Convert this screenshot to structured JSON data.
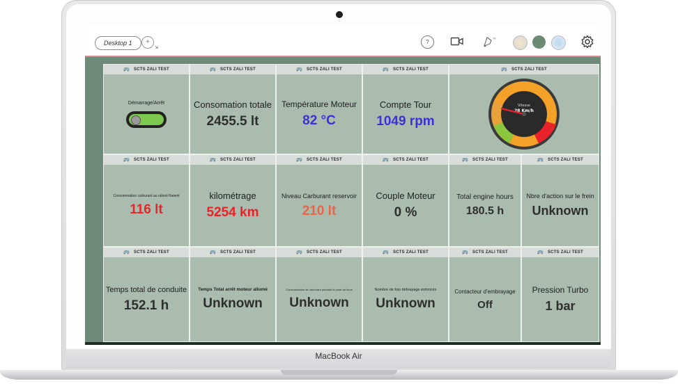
{
  "device": {
    "brand": "MacBook Air"
  },
  "toolbar": {
    "desktop_tab": "Desktop 1",
    "add_tab": "+",
    "help": "?",
    "colors": {
      "accent_line": "#d88a93"
    }
  },
  "dashboard": {
    "tile_header": "SCTS ZALI TEST",
    "colors": {
      "background": "#6e8a79",
      "tile": "#a9bcae",
      "red": "#e8232a",
      "blue": "#3e2fd6",
      "orange": "#e8644a"
    },
    "tiles": {
      "demarrage": {
        "label": "Démarrage/Arrêt"
      },
      "consommation": {
        "label": "Consomation totale",
        "value": "2455.5 lt"
      },
      "temperature": {
        "label": "Température Moteur",
        "value": "82 °C"
      },
      "compte_tour": {
        "label": "Compte Tour",
        "value": "1049 rpm"
      },
      "speed_gauge": {
        "title": "Vitesse",
        "value": "28 Km/h"
      },
      "consommation_ralenti": {
        "label": "Consommation carburant au ralenti Ralenti",
        "value": "116 lt"
      },
      "kilometrage": {
        "label": "kilométrage",
        "value": "5254 km"
      },
      "niveau_carburant": {
        "label": "Niveau Carburant reservoir",
        "value": "210 lt"
      },
      "couple_moteur": {
        "label": "Couple Moteur",
        "value": "0 %"
      },
      "engine_hours": {
        "label": "Total engine hours",
        "value": "180.5 h"
      },
      "frein": {
        "label": "Nbre d'action sur le frein",
        "value": "Unknown"
      },
      "temps_conduite": {
        "label": "Temps total de conduite",
        "value": "152.1 h"
      },
      "arret_moteur": {
        "label": "Temps Total arrêt moteur allumé",
        "value": "Unknown"
      },
      "carburant_pto": {
        "label": "Consommation de carburant pendant la prise de force",
        "value": "Unknown"
      },
      "debrayage": {
        "label": "Nombre de fois débrayage enfoncés",
        "value": "Unknown"
      },
      "embrayage": {
        "label": "Contacteur d'embrayage",
        "value": "Off"
      },
      "turbo": {
        "label": "Pression Turbo",
        "value": "1 bar"
      }
    }
  }
}
